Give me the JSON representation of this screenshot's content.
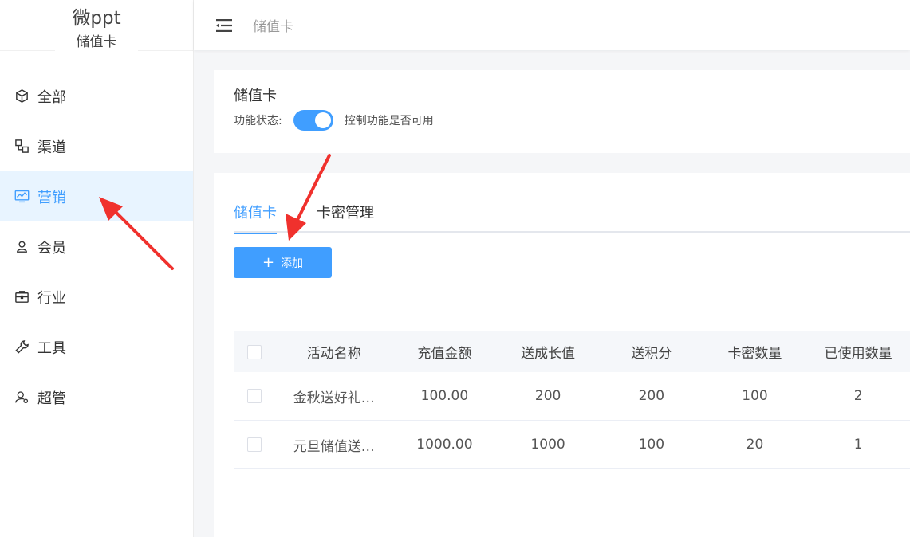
{
  "app": {
    "name": "微ppt",
    "subtitle": "储值卡"
  },
  "sidebar": {
    "items": [
      {
        "label": "全部",
        "icon": "cube-icon"
      },
      {
        "label": "渠道",
        "icon": "channel-icon"
      },
      {
        "label": "营销",
        "icon": "chart-monitor-icon",
        "active": true
      },
      {
        "label": "会员",
        "icon": "user-icon"
      },
      {
        "label": "行业",
        "icon": "briefcase-icon"
      },
      {
        "label": "工具",
        "icon": "wrench-icon"
      },
      {
        "label": "超管",
        "icon": "admin-user-icon"
      }
    ]
  },
  "topbar": {
    "breadcrumb": "储值卡"
  },
  "feature": {
    "title": "储值卡",
    "status_label": "功能状态:",
    "status_on": true,
    "status_hint": "控制功能是否可用"
  },
  "tabs": [
    {
      "label": "储值卡",
      "active": true
    },
    {
      "label": "卡密管理",
      "active": false
    }
  ],
  "actions": {
    "add_label": "添加"
  },
  "table": {
    "headers": [
      "活动名称",
      "充值金额",
      "送成长值",
      "送积分",
      "卡密数量",
      "已使用数量"
    ],
    "rows": [
      [
        "金秋送好礼…",
        "100.00",
        "200",
        "200",
        "100",
        "2"
      ],
      [
        "元旦储值送…",
        "1000.00",
        "1000",
        "100",
        "20",
        "1"
      ]
    ]
  },
  "colors": {
    "accent": "#409eff",
    "annotation_arrow": "#f0312d"
  }
}
